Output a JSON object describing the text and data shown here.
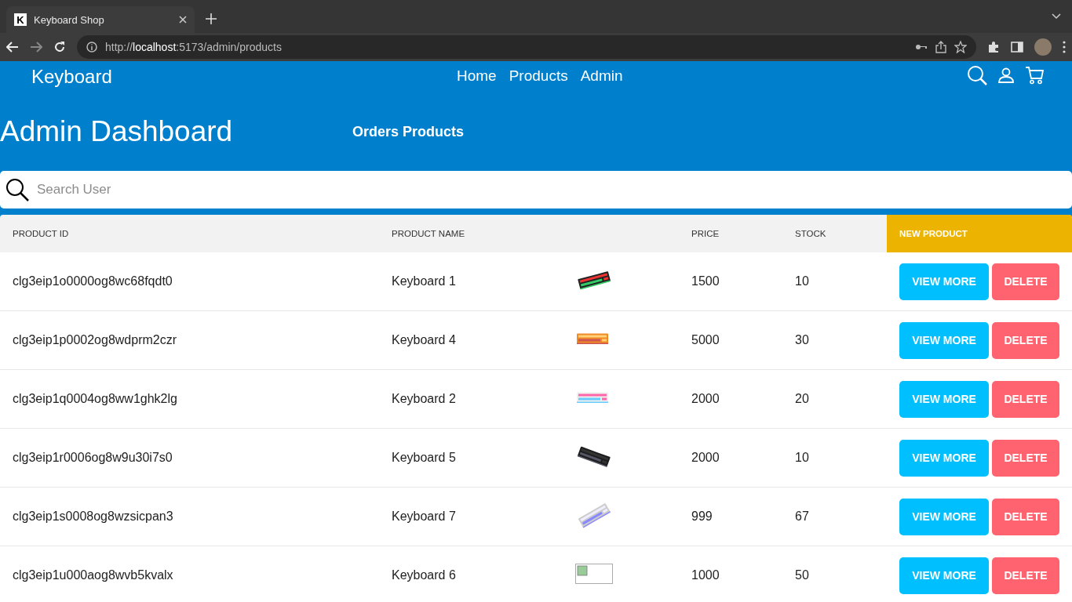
{
  "browser": {
    "tab": {
      "title": "Keyboard Shop",
      "favicon": "K"
    },
    "url": {
      "scheme": "http://",
      "host": "localhost",
      "rest": ":5173/admin/products"
    }
  },
  "header": {
    "brand": "Keyboard",
    "nav": [
      "Home",
      "Products",
      "Admin"
    ]
  },
  "dashboard": {
    "title": "Admin Dashboard",
    "links": "Orders Products"
  },
  "search": {
    "placeholder": "Search User"
  },
  "table": {
    "columns": [
      "PRODUCT ID",
      "PRODUCT NAME",
      "PRICE",
      "STOCK"
    ],
    "new_product": "NEW PRODUCT",
    "rows": [
      {
        "id": "clg3eip1o0000og8wc68fqdt0",
        "name": "Keyboard 1",
        "image": {
          "kind": "picture"
        },
        "price": "1500",
        "stock": "10",
        "actions": [
          "VIEW MORE",
          "DELETE"
        ]
      },
      {
        "id": "clg3eip1p0002og8wdprm2czr",
        "name": "Keyboard 4",
        "image": {
          "kind": "picture"
        },
        "price": "5000",
        "stock": "30",
        "actions": [
          "VIEW MORE",
          "DELETE"
        ]
      },
      {
        "id": "clg3eip1q0004og8ww1ghk2lg",
        "name": "Keyboard 2",
        "image": {
          "kind": "picture"
        },
        "price": "2000",
        "stock": "20",
        "actions": [
          "VIEW MORE",
          "DELETE"
        ]
      },
      {
        "id": "clg3eip1r0006og8w9u30i7s0",
        "name": "Keyboard 5",
        "image": {
          "kind": "picture"
        },
        "price": "2000",
        "stock": "10",
        "actions": [
          "VIEW MORE",
          "DELETE"
        ]
      },
      {
        "id": "clg3eip1s0008og8wzsicpan3",
        "name": "Keyboard 7",
        "image": {
          "kind": "picture"
        },
        "price": "999",
        "stock": "67",
        "actions": [
          "VIEW MORE",
          "DELETE"
        ]
      },
      {
        "id": "clg3eip1u000aog8wvb5kvalx",
        "name": "Keyboard 6",
        "image": {
          "kind": "broken"
        },
        "price": "1000",
        "stock": "50",
        "actions": [
          "VIEW MORE",
          "DELETE"
        ]
      }
    ]
  }
}
